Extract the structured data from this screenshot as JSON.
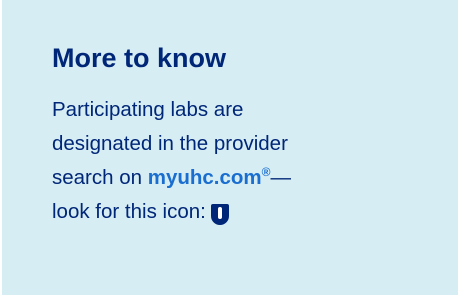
{
  "callout": {
    "title": "More to know",
    "body": {
      "line1": "Participating labs are",
      "line2": "designated in the provider",
      "line3_prefix": "search on ",
      "link_text": "myuhc.com",
      "link_mark": "®",
      "line3_suffix": "—",
      "line4": "look for this icon:",
      "icon": "lab-test-tube-icon"
    },
    "colors": {
      "background": "#d6edf4",
      "text": "#002677",
      "link": "#196ecf"
    }
  }
}
